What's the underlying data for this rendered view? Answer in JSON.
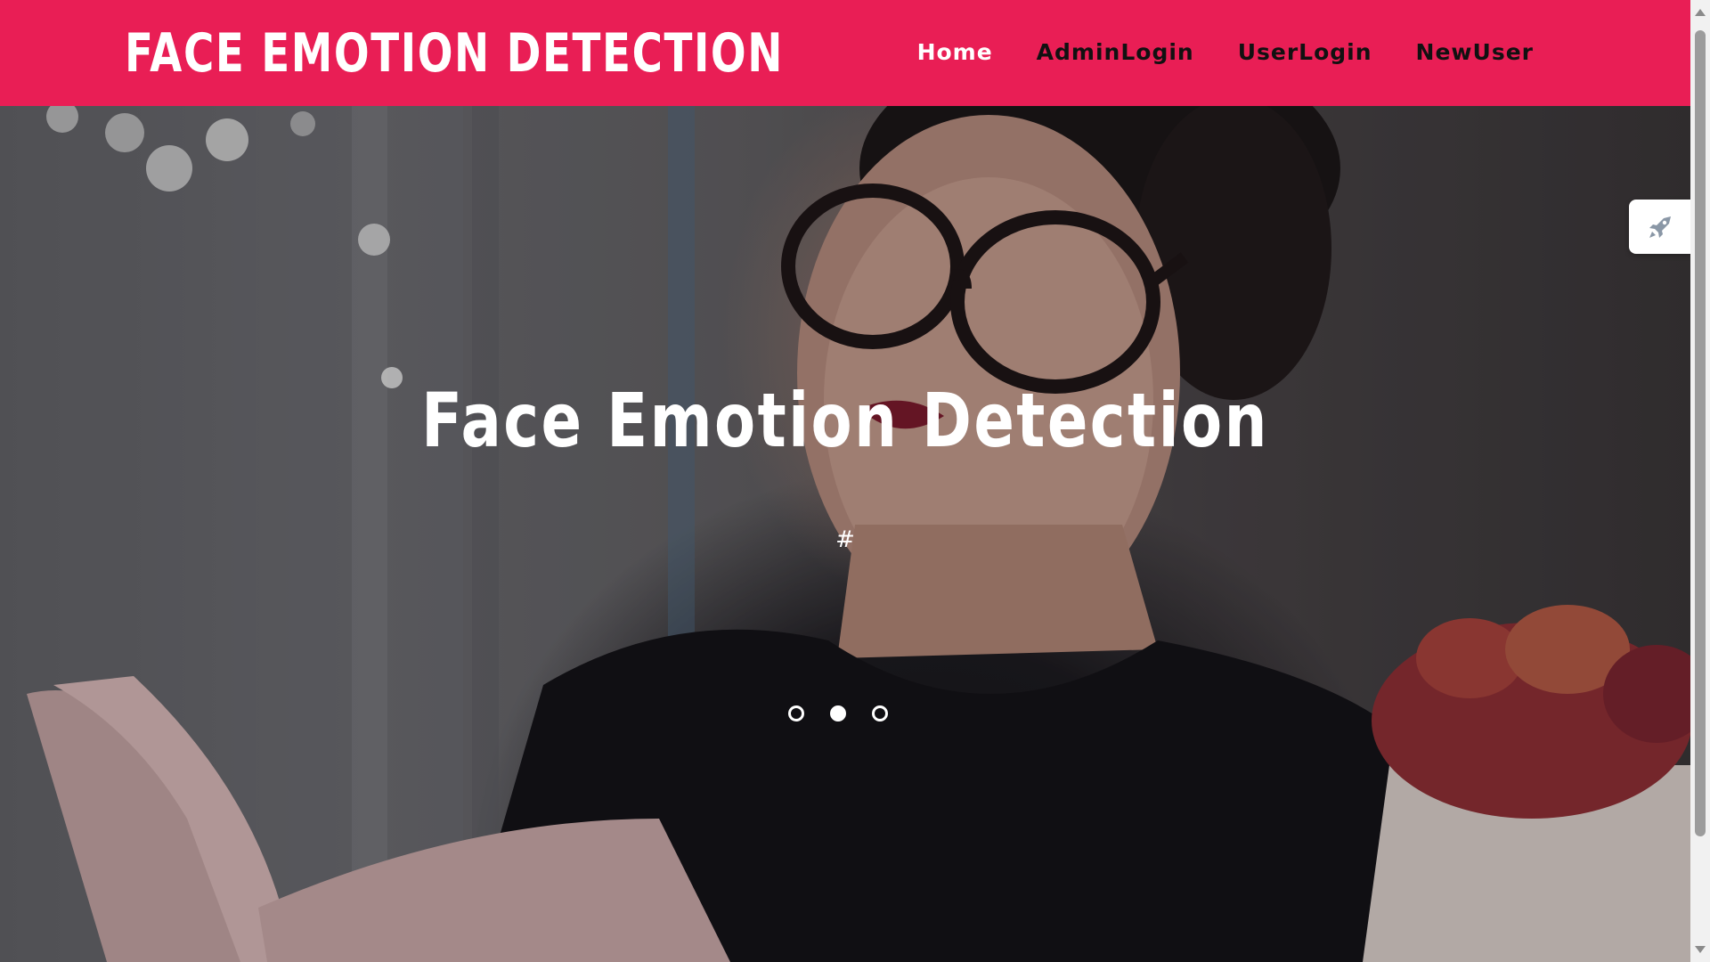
{
  "header": {
    "brand": "FACE EMOTION DETECTION",
    "nav": [
      {
        "label": "Home",
        "active": true
      },
      {
        "label": "AdminLogin",
        "active": false
      },
      {
        "label": "UserLogin",
        "active": false
      },
      {
        "label": "NewUser",
        "active": false
      }
    ]
  },
  "hero": {
    "title": "Face Emotion Detection",
    "subtitle": "#",
    "slides": {
      "count": 3,
      "active_index": 1
    },
    "image_description_icon": "woman-with-glasses-reading-photo"
  },
  "side_widget": {
    "icon": "rocket-icon"
  },
  "colors": {
    "header_bg": "#e91e55",
    "nav_text": "#111111",
    "nav_active_text": "#ffffff",
    "hero_text": "#ffffff"
  }
}
